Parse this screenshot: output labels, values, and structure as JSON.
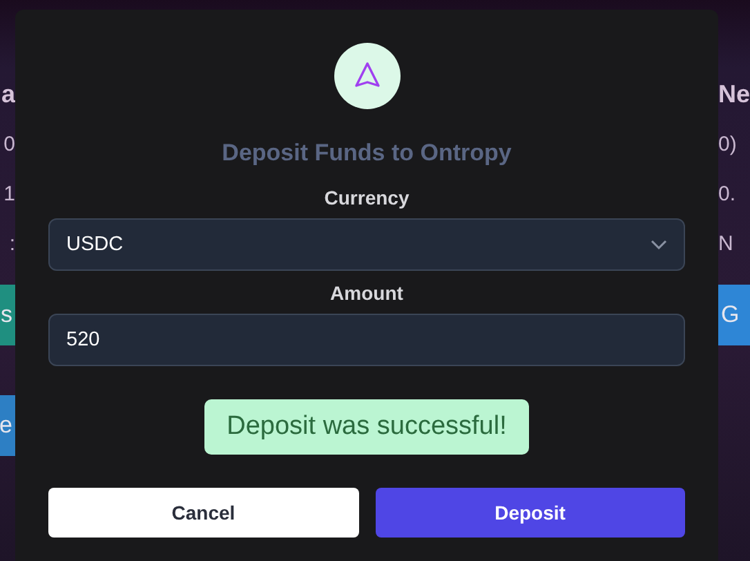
{
  "background": {
    "left": [
      {
        "kind": "heading",
        "text": "a"
      },
      {
        "kind": "text",
        "text": "0"
      },
      {
        "kind": "text",
        "text": "1"
      },
      {
        "kind": "text",
        "text": ":"
      },
      {
        "kind": "button",
        "text": "s",
        "color": "#1f8f80"
      },
      {
        "kind": "button",
        "text": "e",
        "color": "#2d7fc4"
      }
    ],
    "right": [
      {
        "kind": "heading",
        "text": "Ne"
      },
      {
        "kind": "text",
        "text": "0)"
      },
      {
        "kind": "text",
        "text": "0."
      },
      {
        "kind": "text",
        "text": "N"
      },
      {
        "kind": "button",
        "text": "G",
        "color": "#2e86d6"
      }
    ]
  },
  "modal": {
    "title": "Deposit Funds to Ontropy",
    "fields": [
      {
        "kind": "select",
        "label": "Currency",
        "value": "USDC"
      },
      {
        "kind": "input",
        "label": "Amount",
        "value": "520"
      }
    ],
    "alert": "Deposit was successful!",
    "buttons": [
      {
        "kind": "secondary",
        "label": "Cancel"
      },
      {
        "kind": "primary",
        "label": "Deposit"
      }
    ]
  }
}
